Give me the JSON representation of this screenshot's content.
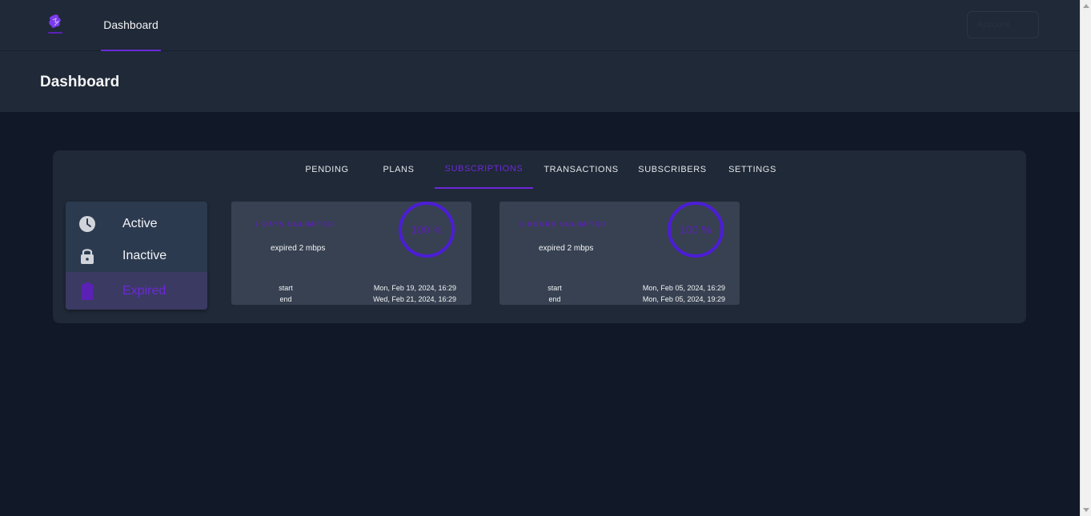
{
  "nav": {
    "dashboard_label": "Dashboard",
    "account_label": "Account"
  },
  "header": {
    "title": "Dashboard"
  },
  "tabs": [
    {
      "label": "PENDING"
    },
    {
      "label": "PLANS"
    },
    {
      "label": "SUBSCRIPTIONS",
      "active": true
    },
    {
      "label": "TRANSACTIONS"
    },
    {
      "label": "SUBSCRIBERS"
    },
    {
      "label": "SETTINGS"
    }
  ],
  "menu": {
    "items": [
      {
        "label": "Active",
        "icon": "clock-icon"
      },
      {
        "label": "Inactive",
        "icon": "lock-icon"
      },
      {
        "label": "Expired",
        "icon": "battery-icon",
        "selected": true
      }
    ]
  },
  "subscriptions": [
    {
      "title": "2 DAYS UNLIMITED",
      "status": "expired 2 mbps",
      "progress_text": "100 %",
      "progress_fraction": 1.0,
      "start_label": "start",
      "start_value": "Mon, Feb 19, 2024, 16:29",
      "end_label": "end",
      "end_value": "Wed, Feb 21, 2024, 16:29"
    },
    {
      "title": "3 HOURS UNLIMITED",
      "status": "expired 2 mbps",
      "progress_text": "100 %",
      "progress_fraction": 1.0,
      "start_label": "start",
      "start_value": "Mon, Feb 05, 2024, 16:29",
      "end_label": "end",
      "end_value": "Mon, Feb 05, 2024, 19:29"
    }
  ],
  "colors": {
    "accent": "#6d28d9",
    "ring": "#4c1dd6",
    "background": "#111827",
    "surface": "#1f2937",
    "card": "#374151"
  }
}
